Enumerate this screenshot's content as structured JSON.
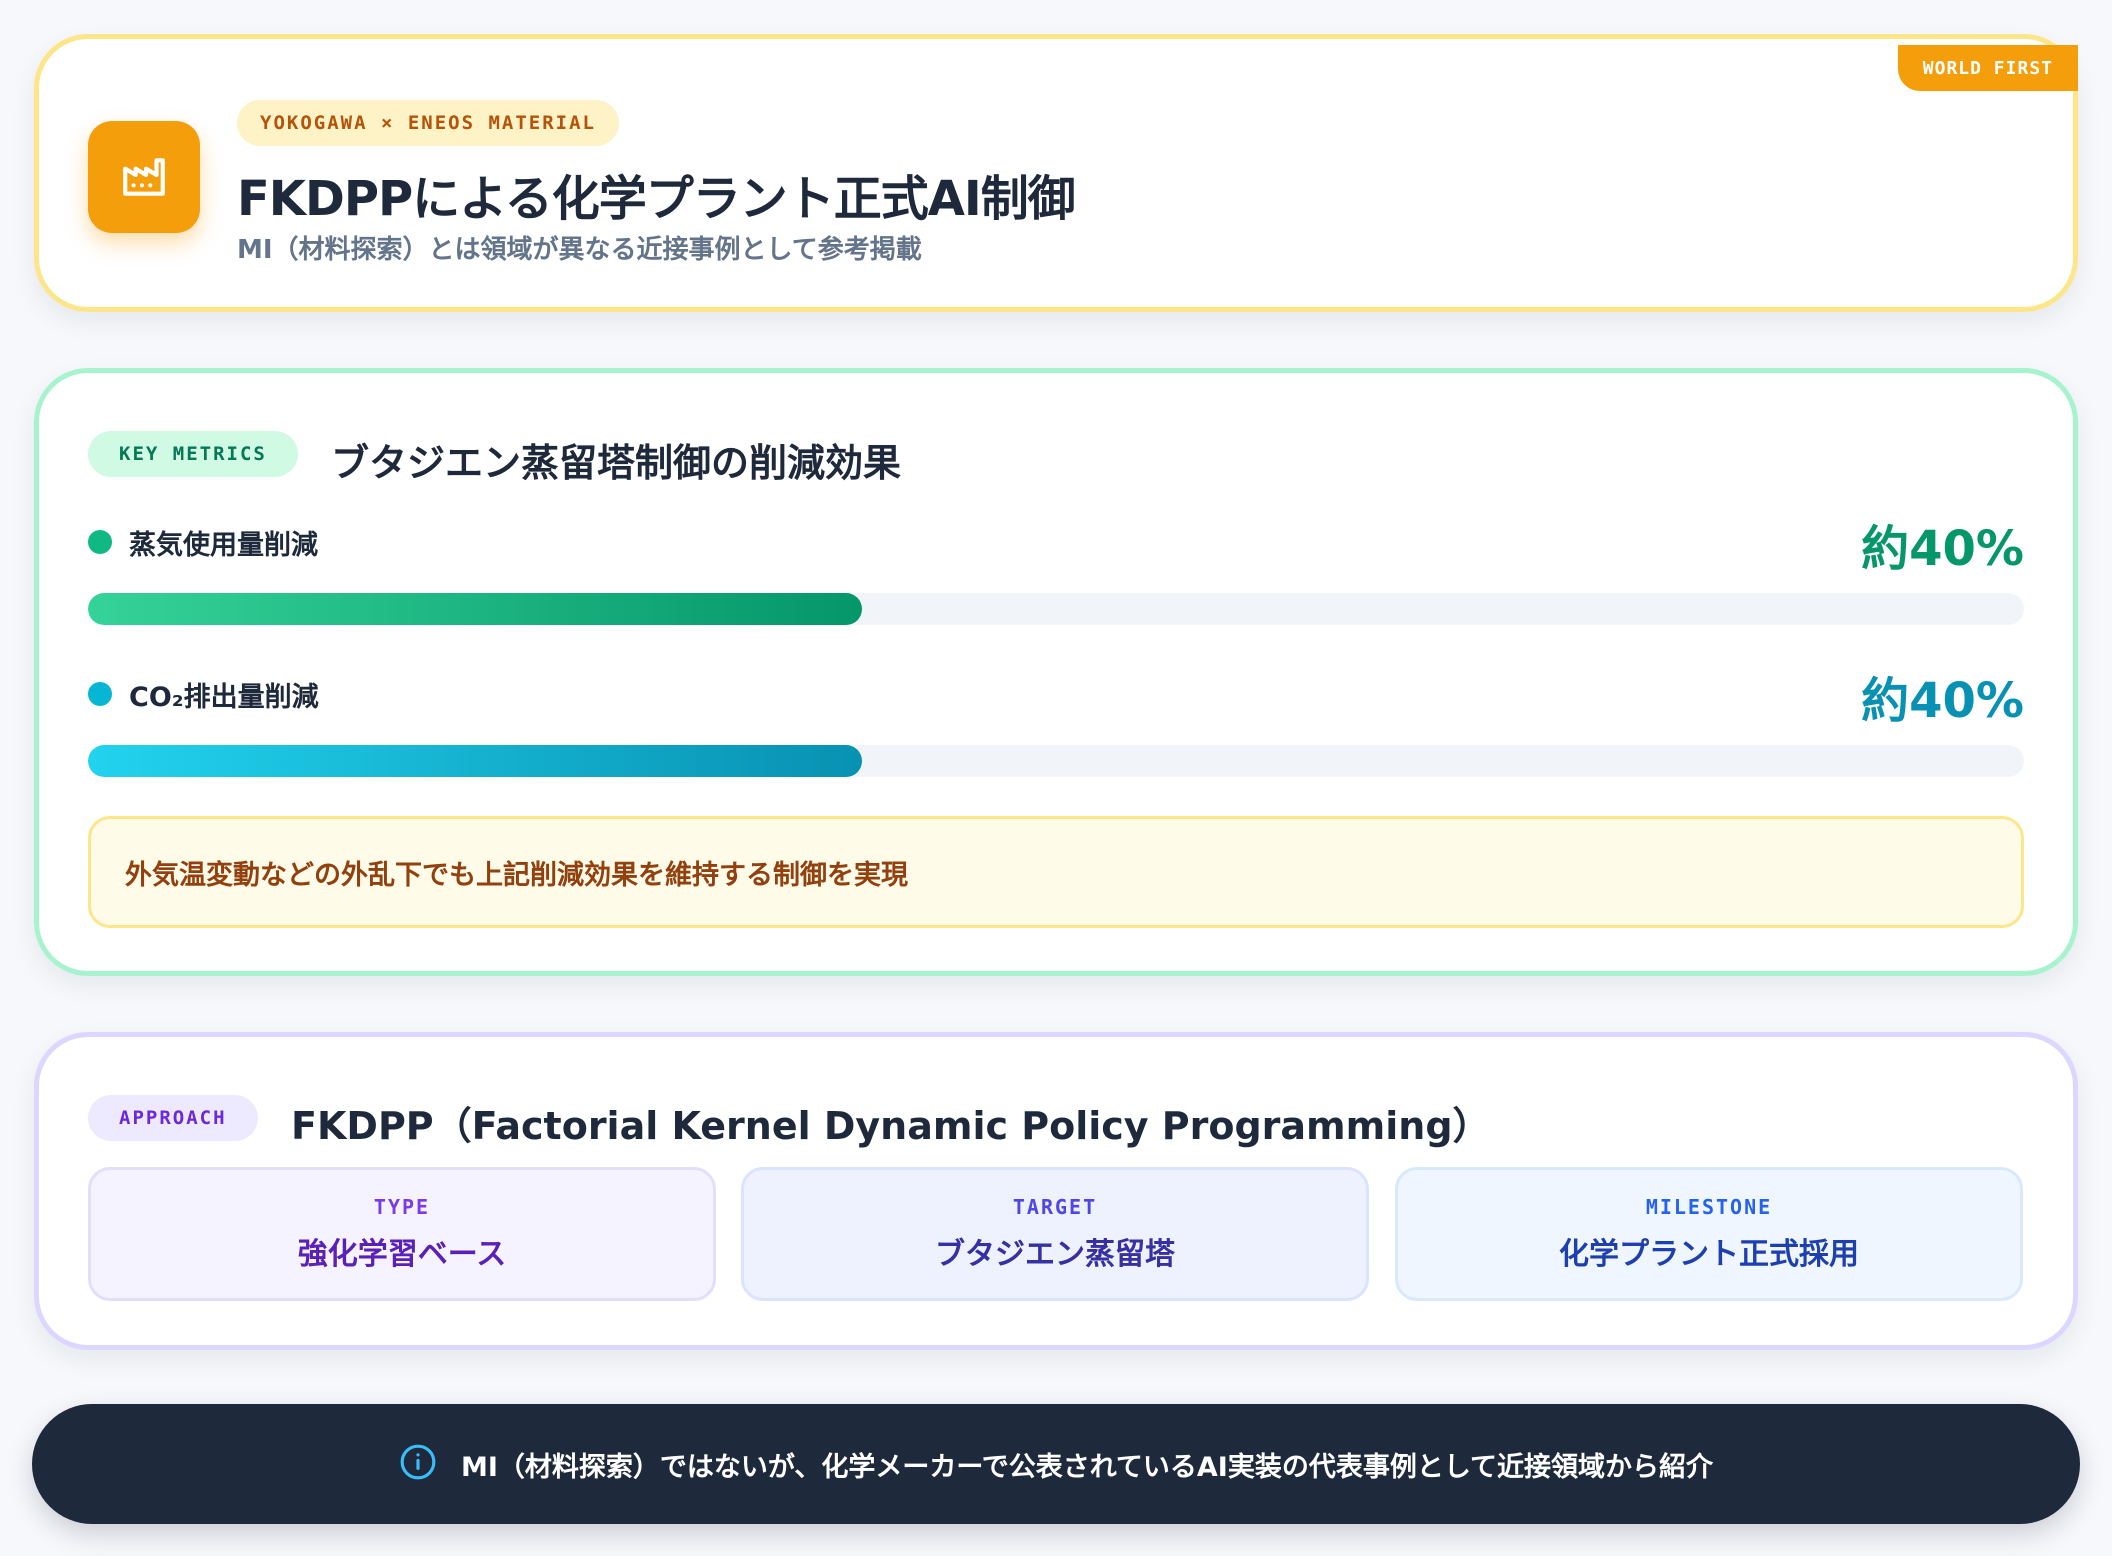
{
  "header": {
    "badge": "WORLD FIRST",
    "tag": "YOKOGAWA × ENEOS MATERIAL",
    "title": "FKDPPによる化学プラント正式AI制御",
    "subtitle": "MI（材料探索）とは領域が異なる近接事例として参考掲載",
    "icon": "factory-icon"
  },
  "metrics": {
    "section_tag": "KEY METRICS",
    "title": "ブタジエン蒸留塔制御の削減効果",
    "items": [
      {
        "label": "蒸気使用量削減",
        "value": "約40%",
        "fraction": 0.4,
        "color": "#10b981"
      },
      {
        "label": "CO₂排出量削減",
        "value": "約40%",
        "fraction": 0.4,
        "color": "#06b6d4"
      }
    ],
    "note": "外気温変動などの外乱下でも上記削減効果を維持する制御を実現"
  },
  "approach": {
    "section_tag": "APPROACH",
    "title": "FKDPP（Factorial Kernel Dynamic Policy Programming）",
    "tiles": [
      {
        "label": "TYPE",
        "value": "強化学習ベース"
      },
      {
        "label": "TARGET",
        "value": "ブタジエン蒸留塔"
      },
      {
        "label": "MILESTONE",
        "value": "化学プラント正式採用"
      }
    ]
  },
  "footer": {
    "icon": "info-icon",
    "text": "MI（材料探索）ではないが、化学メーカーで公表されているAI実装の代表事例として近接領域から紹介"
  },
  "colors": {
    "accent_amber": "#f59e0b",
    "metric_green": "#059669",
    "metric_cyan": "#0891b2",
    "footer_bg": "#1e293b"
  }
}
